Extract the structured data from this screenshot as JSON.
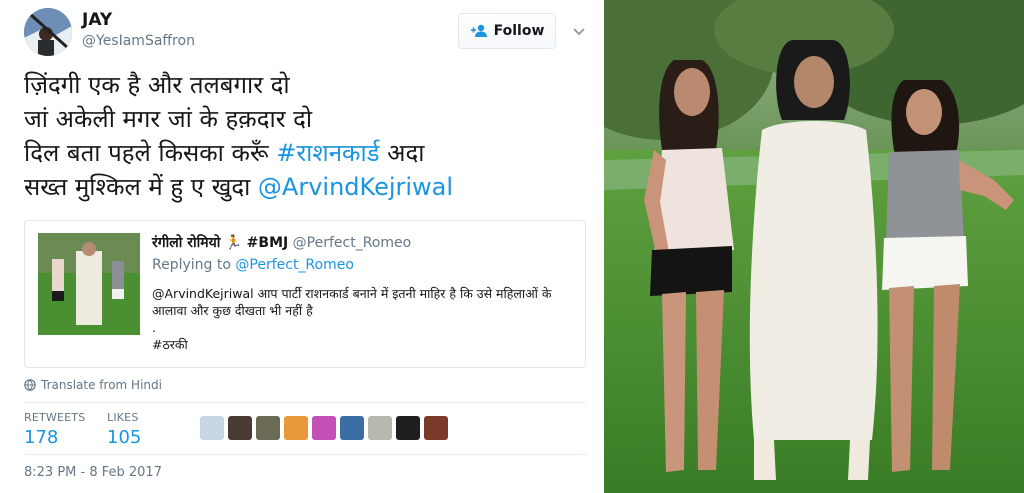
{
  "author": {
    "display_name": "JAY",
    "handle": "@YesIamSaffron"
  },
  "follow_button": {
    "label": "Follow",
    "icon": "add-user-icon"
  },
  "tweet": {
    "lines": [
      "ज़िंदगी एक है और तलबगार दो",
      "जां अकेली मगर जां के हक़दार दो",
      "दिल बता पहले किसका करूँ",
      "सख्त मुश्किल में हु ए खुदा"
    ],
    "hashtag": "#राशनकार्ड",
    "line3_tail": "अदा",
    "mention": "@ArvindKejriwal"
  },
  "quoted_tweet": {
    "name": "रंगीलो रोमियो",
    "name_emoji": "🏃",
    "name_tag": "#BMJ",
    "handle": "@Perfect_Romeo",
    "replying_prefix": "Replying to",
    "replying_to": "@Perfect_Romeo",
    "mention": "@ArvindKejriwal",
    "text_line1": "आप पार्टी राशनकार्ड बनाने में इतनी माहिर है कि उसे महिलाओं के",
    "text_line2": "आलावा और कुछ दीखता भी नहीं है",
    "dot": ".",
    "hashtag": "#ठरकी"
  },
  "translate": {
    "label": "Translate from Hindi",
    "icon": "globe-icon"
  },
  "stats": {
    "retweets_label": "RETWEETS",
    "retweets": "178",
    "likes_label": "LIKES",
    "likes": "105"
  },
  "likers": [
    {
      "color": "#c8d6e2"
    },
    {
      "color": "#4a3b34"
    },
    {
      "color": "#6a6a55"
    },
    {
      "color": "#e89a3a"
    },
    {
      "color": "#c24fb4"
    },
    {
      "color": "#3b6fa3"
    },
    {
      "color": "#b8b8b0"
    },
    {
      "color": "#1f1f1f"
    },
    {
      "color": "#7a3a2a"
    }
  ],
  "timestamp": "8:23 PM - 8 Feb 2017",
  "colors": {
    "link": "#1b95e0",
    "muted": "#657786",
    "border": "#e1e8ed"
  }
}
